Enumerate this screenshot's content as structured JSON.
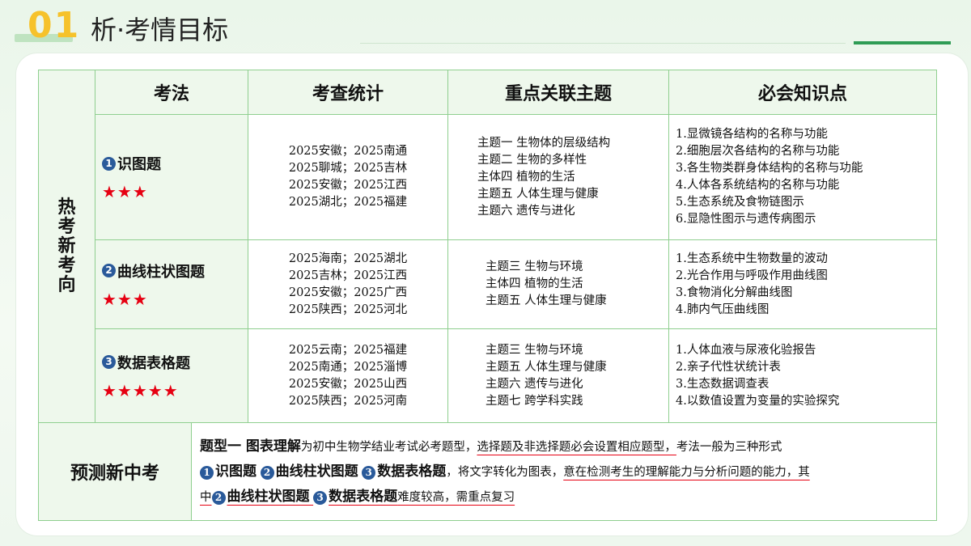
{
  "header": {
    "number": "01",
    "title": "析·考情目标"
  },
  "side_label": "热考新考向",
  "columns": [
    "考法",
    "考查统计",
    "重点关联主题",
    "必会知识点"
  ],
  "rows": [
    {
      "badge": "1",
      "name": "识图题",
      "stars": "★★★",
      "stats": [
        "2025安徽；2025南通",
        "2025聊城；2025吉林",
        "2025安徽；2025江西",
        "2025湖北；2025福建"
      ],
      "topics": [
        "主题一  生物体的层级结构",
        "主题二  生物的多样性",
        "主体四  植物的生活",
        "主题五  人体生理与健康",
        "主题六  遗传与进化"
      ],
      "knowledge": [
        "1.显微镜各结构的名称与功能",
        "2.细胞层次各结构的名称与功能",
        "3.各生物类群身体结构的名称与功能",
        "4.人体各系统结构的名称与功能",
        "5.生态系统及食物链图示",
        "6.显隐性图示与遗传病图示"
      ]
    },
    {
      "badge": "2",
      "name": "曲线柱状图题",
      "stars": "★★★",
      "stats": [
        "2025海南；2025湖北",
        "2025吉林；2025江西",
        "2025安徽；2025广西",
        "2025陕西；2025河北"
      ],
      "topics": [
        "主题三  生物与环境",
        "主体四  植物的生活",
        "主题五  人体生理与健康"
      ],
      "knowledge": [
        "1.生态系统中生物数量的波动",
        "2.光合作用与呼吸作用曲线图",
        "3.食物消化分解曲线图",
        "4.肺内气压曲线图"
      ]
    },
    {
      "badge": "3",
      "name": "数据表格题",
      "stars": "★★★★★",
      "stats": [
        "2025云南；2025福建",
        "2025南通；2025淄博",
        "2025安徽；2025山西",
        "2025陕西；2025河南"
      ],
      "topics": [
        "主题三  生物与环境",
        "主题五  人体生理与健康",
        "主题六  遗传与进化",
        "主题七  跨学科实践"
      ],
      "knowledge": [
        "1.人体血液与尿液化验报告",
        "2.亲子代性状统计表",
        "3.生态数据调查表",
        "4.以数值设置为变量的实验探究"
      ]
    }
  ],
  "prediction": {
    "label": "预测新中考",
    "l1_bold": "题型一 图表理解",
    "l1_text": "为初中生物学结业考试必考题型，",
    "l1_ul": "选择题及非选择题必会设置相应题型，",
    "l1_end": "考法一般为三种形式",
    "l2_b1": "识图题",
    "l2_b2": "曲线柱状图题",
    "l2_b3": "数据表格题",
    "l2_text": "，将文字转化为图表，",
    "l2_ul": "意在检测考生的理解能力与分析问题的能力，其",
    "l3_pre": "中",
    "l3_b2": "曲线柱状图题",
    "l3_b3": "数据表格题",
    "l3_end": "难度较高，需重点复习"
  }
}
